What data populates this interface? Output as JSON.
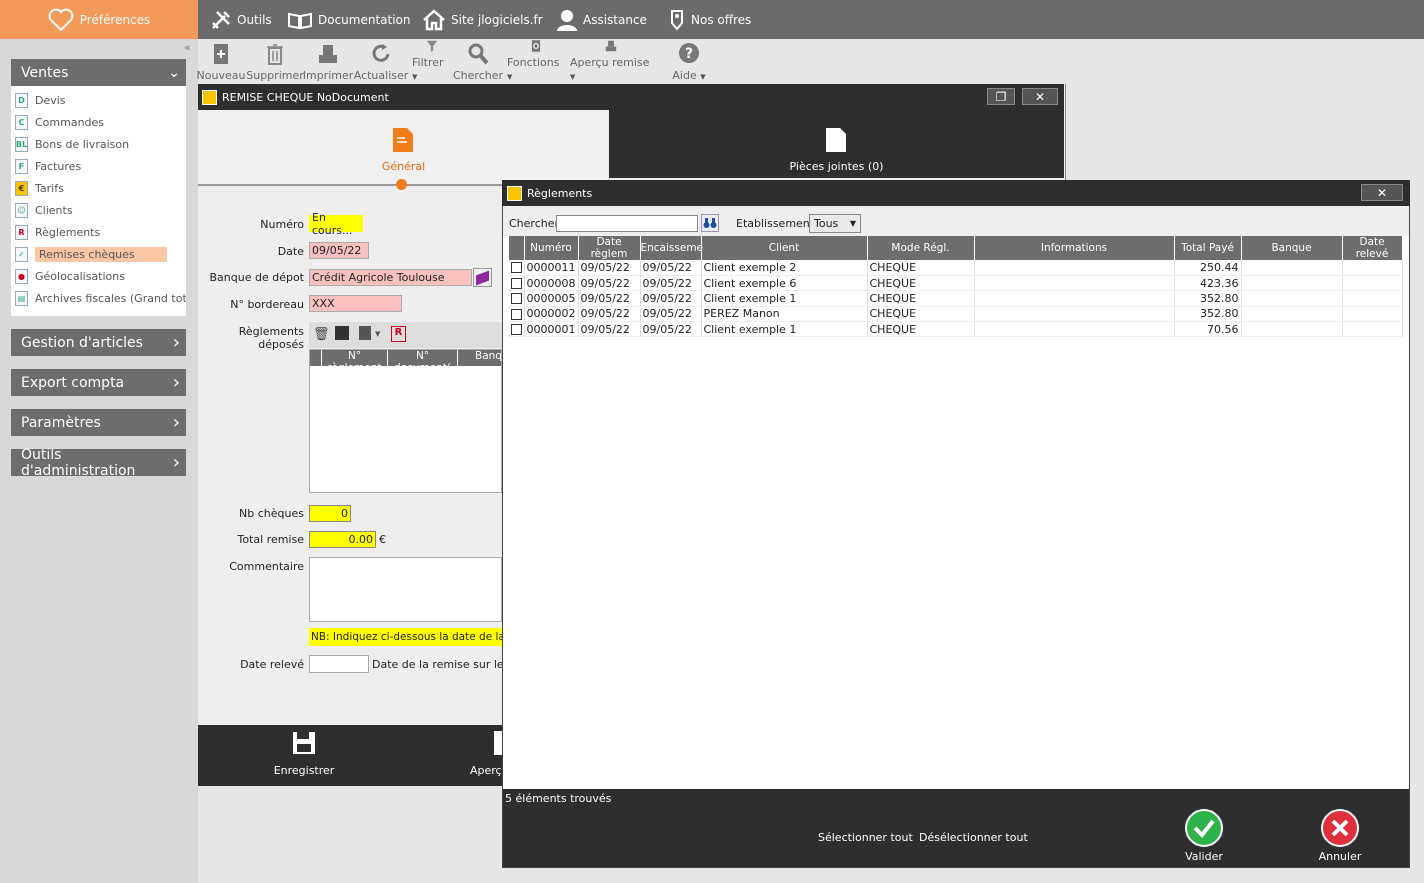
{
  "topnav": {
    "preferences": "Préférences",
    "items": [
      {
        "label": "Outils",
        "icon": "tools-icon"
      },
      {
        "label": "Documentation",
        "icon": "book-icon"
      },
      {
        "label": "Site jlogiciels.fr",
        "icon": "home-icon"
      },
      {
        "label": "Assistance",
        "icon": "user-icon"
      },
      {
        "label": "Nos offres",
        "icon": "tag-icon"
      }
    ]
  },
  "sidebar": {
    "ventes": {
      "title": "Ventes",
      "items": [
        {
          "label": "Devis",
          "icon": "D"
        },
        {
          "label": "Commandes",
          "icon": "C"
        },
        {
          "label": "Bons de livraison",
          "icon": "BL"
        },
        {
          "label": "Factures",
          "icon": "F"
        },
        {
          "label": "Tarifs",
          "icon": "€"
        },
        {
          "label": "Clients",
          "icon": "☺"
        },
        {
          "label": "Règlements",
          "icon": "R"
        },
        {
          "label": "Remises chèques",
          "icon": "✓"
        },
        {
          "label": "Géolocalisations",
          "icon": "●"
        },
        {
          "label": "Archives fiscales (Grand totaux)",
          "icon": "▤"
        }
      ]
    },
    "sections": [
      "Gestion d'articles",
      "Export compta",
      "Paramètres",
      "Outils d'administration"
    ]
  },
  "toolbar": {
    "nouveau": "Nouveau",
    "supprimer": "Supprimer",
    "imprimer": "Imprimer",
    "actualiser": "Actualiser",
    "filtrer": "Filtrer",
    "chercher": "Chercher",
    "fonctions": "Fonctions",
    "apercu": "Aperçu remise",
    "aide": "Aide"
  },
  "remise": {
    "title": "REMISE CHEQUE NoDocument",
    "tab_general": "Général",
    "tab_pieces": "Pièces jointes (0)",
    "labels": {
      "numero": "Numéro",
      "date": "Date",
      "banque": "Banque de dépot",
      "bordereau": "N° bordereau",
      "reglements": "Règlements déposés",
      "nb_cheques": "Nb chèques",
      "total": "Total remise",
      "commentaire": "Commentaire",
      "date_releve": "Date relevé"
    },
    "values": {
      "numero": "En cours...",
      "date": "09/05/22",
      "banque": "Crédit Agricole Toulouse",
      "bordereau": "XXX",
      "nb_cheques": "0",
      "total": "0.00",
      "currency": "€",
      "nb_note": "NB: Indiquez ci-dessous la date de la re",
      "date_releve_note": "Date de la remise sur le rel"
    },
    "subgrid_headers": [
      "N° règlement",
      "N° document(",
      "Banq"
    ],
    "footer": {
      "save": "Enregistrer",
      "apercu": "Aperç"
    }
  },
  "reglements": {
    "title": "Règlements",
    "search_label": "Chercher",
    "search_value": "",
    "etab_label": "Etablissement:",
    "etab_value": "Tous",
    "headers": [
      "Numéro",
      "Date règlem",
      "Encaisseme",
      "Client",
      "Mode Régl.",
      "Informations",
      "Total Payé",
      "Banque",
      "Date relevé"
    ],
    "rows": [
      [
        "0000011",
        "09/05/22",
        "09/05/22",
        "Client exemple 2",
        "CHEQUE",
        "",
        "250.44",
        "",
        ""
      ],
      [
        "0000008",
        "09/05/22",
        "09/05/22",
        "Client exemple 6",
        "CHEQUE",
        "",
        "423.36",
        "",
        ""
      ],
      [
        "0000005",
        "09/05/22",
        "09/05/22",
        "Client exemple 1",
        "CHEQUE",
        "",
        "352.80",
        "",
        ""
      ],
      [
        "0000002",
        "09/05/22",
        "09/05/22",
        "PEREZ Manon",
        "CHEQUE",
        "",
        "352.80",
        "",
        ""
      ],
      [
        "0000001",
        "09/05/22",
        "09/05/22",
        "Client exemple 1",
        "CHEQUE",
        "",
        "70.56",
        "",
        ""
      ]
    ],
    "count_text": "5 éléments trouvés",
    "select_all": "Sélectionner tout",
    "deselect_all": "Désélectionner tout",
    "valider": "Valider",
    "annuler": "Annuler"
  }
}
